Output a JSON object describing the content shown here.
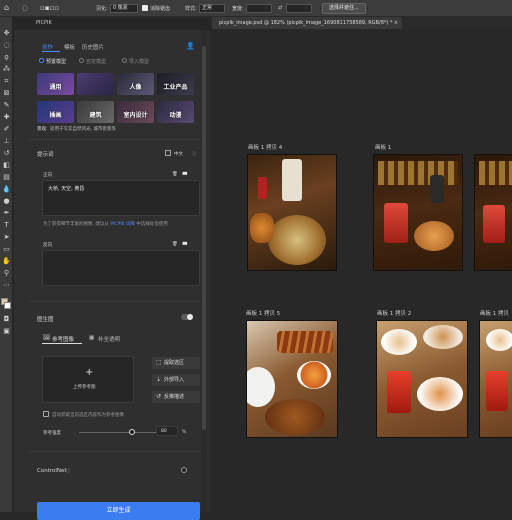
{
  "options_bar": {
    "feather_label": "羽化:",
    "feather_value": "0 像素",
    "antialias_label": "消除锯齿",
    "style_label": "样式:",
    "style_value": "正常",
    "width_label": "宽度:",
    "select_mask_button": "选择并遮住..."
  },
  "document": {
    "tab_title": "picpik_image.psd @ 182% (picpik_image_1690811758589, RGB/8*) *"
  },
  "panel": {
    "header_title": "PICPIK",
    "tabs": [
      {
        "label": "创作",
        "active": true
      },
      {
        "label": "模板",
        "active": false
      },
      {
        "label": "历史图片",
        "active": false
      }
    ],
    "modes": [
      {
        "label": "预置模型",
        "selected": true
      },
      {
        "label": "自定模型",
        "selected": false
      },
      {
        "label": "导入模型",
        "selected": false
      }
    ],
    "categories": [
      {
        "label": "通用"
      },
      {
        "label": ""
      },
      {
        "label": "人像"
      },
      {
        "label": "工业产品"
      },
      {
        "label": "插画"
      },
      {
        "label": "建筑"
      },
      {
        "label": "室内设计"
      },
      {
        "label": "动漫"
      }
    ],
    "scene_note_label": "景观:",
    "scene_note_text": "适用于写实自然风光, 城市街景等",
    "prompt_section_label": "提示词",
    "chinese_label": "中文",
    "positive_label": "正向",
    "positive_text": "大桥, 天空, 黄昏",
    "tip_text": "为了获得细节丰富的图像, 建议从 PICPIK 词库 中选择标签使用",
    "tip_link": "PICPIK 词库",
    "negative_label": "反向",
    "image_to_image_label": "图生图",
    "ref_tab_label": "参考图像",
    "fill_tab_label": "补全透明",
    "upload_label": "上传参考图",
    "extract_button": "提取选区",
    "external_import_button": "外部导入",
    "reverse_prompt_button": "反推描述",
    "auto_fill_text": "自动获取当前选区内容作为参考图像",
    "ref_strength_label": "参考强度",
    "ref_strength_value": "80",
    "ref_strength_unit": "%",
    "controlnet_label": "ControlNet",
    "generate_button": "立即生成"
  },
  "artboards": [
    {
      "label": "画板 1 拷贝 4"
    },
    {
      "label": "画板 1"
    },
    {
      "label": "画板 1 拷贝 5"
    },
    {
      "label": "画板 1 拷贝 2"
    },
    {
      "label": "画板 1 拷贝"
    }
  ],
  "colors": {
    "accent": "#4a8cff",
    "generate": "#3b7cf0",
    "panel_bg": "#2f2f2f",
    "canvas_bg": "#282828"
  }
}
